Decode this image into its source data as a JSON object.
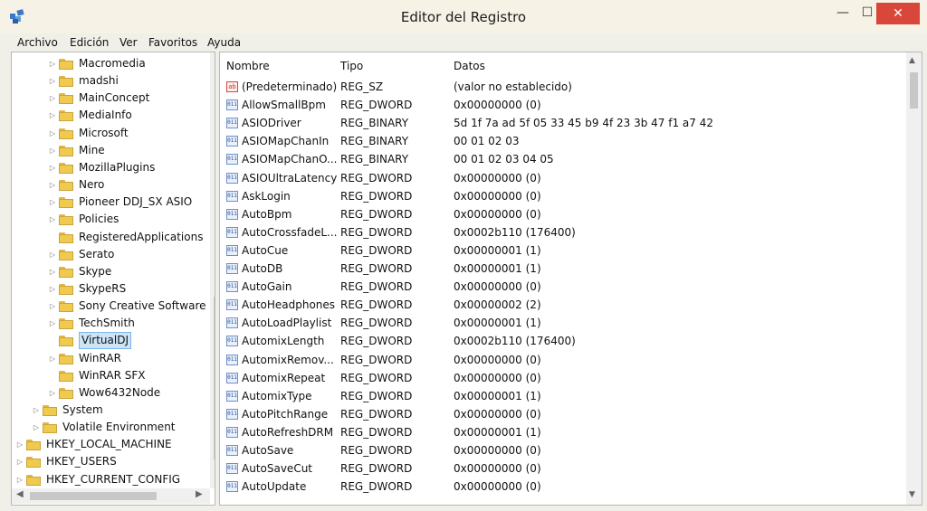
{
  "window": {
    "title": "Editor del Registro"
  },
  "controls": {
    "minimize": "—",
    "maximize": "☐",
    "close": "✕"
  },
  "menu": [
    "Archivo",
    "Edición",
    "Ver",
    "Favoritos",
    "Ayuda"
  ],
  "tree": [
    {
      "label": "Macromedia",
      "level": 2,
      "expander": true,
      "selected": false
    },
    {
      "label": "madshi",
      "level": 2,
      "expander": true,
      "selected": false
    },
    {
      "label": "MainConcept",
      "level": 2,
      "expander": true,
      "selected": false
    },
    {
      "label": "MediaInfo",
      "level": 2,
      "expander": true,
      "selected": false
    },
    {
      "label": "Microsoft",
      "level": 2,
      "expander": true,
      "selected": false
    },
    {
      "label": "Mine",
      "level": 2,
      "expander": true,
      "selected": false
    },
    {
      "label": "MozillaPlugins",
      "level": 2,
      "expander": true,
      "selected": false
    },
    {
      "label": "Nero",
      "level": 2,
      "expander": true,
      "selected": false
    },
    {
      "label": "Pioneer DDJ_SX ASIO",
      "level": 2,
      "expander": true,
      "selected": false
    },
    {
      "label": "Policies",
      "level": 2,
      "expander": true,
      "selected": false
    },
    {
      "label": "RegisteredApplications",
      "level": 2,
      "expander": false,
      "selected": false
    },
    {
      "label": "Serato",
      "level": 2,
      "expander": true,
      "selected": false
    },
    {
      "label": "Skype",
      "level": 2,
      "expander": true,
      "selected": false
    },
    {
      "label": "SkypeRS",
      "level": 2,
      "expander": true,
      "selected": false
    },
    {
      "label": "Sony Creative Software",
      "level": 2,
      "expander": true,
      "selected": false
    },
    {
      "label": "TechSmith",
      "level": 2,
      "expander": true,
      "selected": false
    },
    {
      "label": "VirtualDJ",
      "level": 2,
      "expander": false,
      "selected": true
    },
    {
      "label": "WinRAR",
      "level": 2,
      "expander": true,
      "selected": false
    },
    {
      "label": "WinRAR SFX",
      "level": 2,
      "expander": false,
      "selected": false
    },
    {
      "label": "Wow6432Node",
      "level": 2,
      "expander": true,
      "selected": false
    },
    {
      "label": "System",
      "level": 1,
      "expander": true,
      "selected": false
    },
    {
      "label": "Volatile Environment",
      "level": 1,
      "expander": true,
      "selected": false
    },
    {
      "label": "HKEY_LOCAL_MACHINE",
      "level": 0,
      "expander": true,
      "selected": false
    },
    {
      "label": "HKEY_USERS",
      "level": 0,
      "expander": true,
      "selected": false
    },
    {
      "label": "HKEY_CURRENT_CONFIG",
      "level": 0,
      "expander": true,
      "selected": false
    }
  ],
  "columns": {
    "name": "Nombre",
    "type": "Tipo",
    "data": "Datos"
  },
  "values": [
    {
      "icon": "ab",
      "name": "(Predeterminado)",
      "type": "REG_SZ",
      "data": "(valor no establecido)"
    },
    {
      "icon": "bin",
      "name": "AllowSmallBpm",
      "type": "REG_DWORD",
      "data": "0x00000000 (0)"
    },
    {
      "icon": "bin",
      "name": "ASIODriver",
      "type": "REG_BINARY",
      "data": "5d 1f 7a ad 5f 05 33 45 b9 4f 23 3b 47 f1 a7 42"
    },
    {
      "icon": "bin",
      "name": "ASIOMapChanIn",
      "type": "REG_BINARY",
      "data": "00 01 02 03"
    },
    {
      "icon": "bin",
      "name": "ASIOMapChanO...",
      "type": "REG_BINARY",
      "data": "00 01 02 03 04 05"
    },
    {
      "icon": "bin",
      "name": "ASIOUltraLatency",
      "type": "REG_DWORD",
      "data": "0x00000000 (0)"
    },
    {
      "icon": "bin",
      "name": "AskLogin",
      "type": "REG_DWORD",
      "data": "0x00000000 (0)"
    },
    {
      "icon": "bin",
      "name": "AutoBpm",
      "type": "REG_DWORD",
      "data": "0x00000000 (0)"
    },
    {
      "icon": "bin",
      "name": "AutoCrossfadeL...",
      "type": "REG_DWORD",
      "data": "0x0002b110 (176400)"
    },
    {
      "icon": "bin",
      "name": "AutoCue",
      "type": "REG_DWORD",
      "data": "0x00000001 (1)"
    },
    {
      "icon": "bin",
      "name": "AutoDB",
      "type": "REG_DWORD",
      "data": "0x00000001 (1)"
    },
    {
      "icon": "bin",
      "name": "AutoGain",
      "type": "REG_DWORD",
      "data": "0x00000000 (0)"
    },
    {
      "icon": "bin",
      "name": "AutoHeadphones",
      "type": "REG_DWORD",
      "data": "0x00000002 (2)"
    },
    {
      "icon": "bin",
      "name": "AutoLoadPlaylist",
      "type": "REG_DWORD",
      "data": "0x00000001 (1)"
    },
    {
      "icon": "bin",
      "name": "AutomixLength",
      "type": "REG_DWORD",
      "data": "0x0002b110 (176400)"
    },
    {
      "icon": "bin",
      "name": "AutomixRemov...",
      "type": "REG_DWORD",
      "data": "0x00000000 (0)"
    },
    {
      "icon": "bin",
      "name": "AutomixRepeat",
      "type": "REG_DWORD",
      "data": "0x00000000 (0)"
    },
    {
      "icon": "bin",
      "name": "AutomixType",
      "type": "REG_DWORD",
      "data": "0x00000001 (1)"
    },
    {
      "icon": "bin",
      "name": "AutoPitchRange",
      "type": "REG_DWORD",
      "data": "0x00000000 (0)"
    },
    {
      "icon": "bin",
      "name": "AutoRefreshDRM",
      "type": "REG_DWORD",
      "data": "0x00000001 (1)"
    },
    {
      "icon": "bin",
      "name": "AutoSave",
      "type": "REG_DWORD",
      "data": "0x00000000 (0)"
    },
    {
      "icon": "bin",
      "name": "AutoSaveCut",
      "type": "REG_DWORD",
      "data": "0x00000000 (0)"
    },
    {
      "icon": "bin",
      "name": "AutoUpdate",
      "type": "REG_DWORD",
      "data": "0x00000000 (0)"
    }
  ]
}
